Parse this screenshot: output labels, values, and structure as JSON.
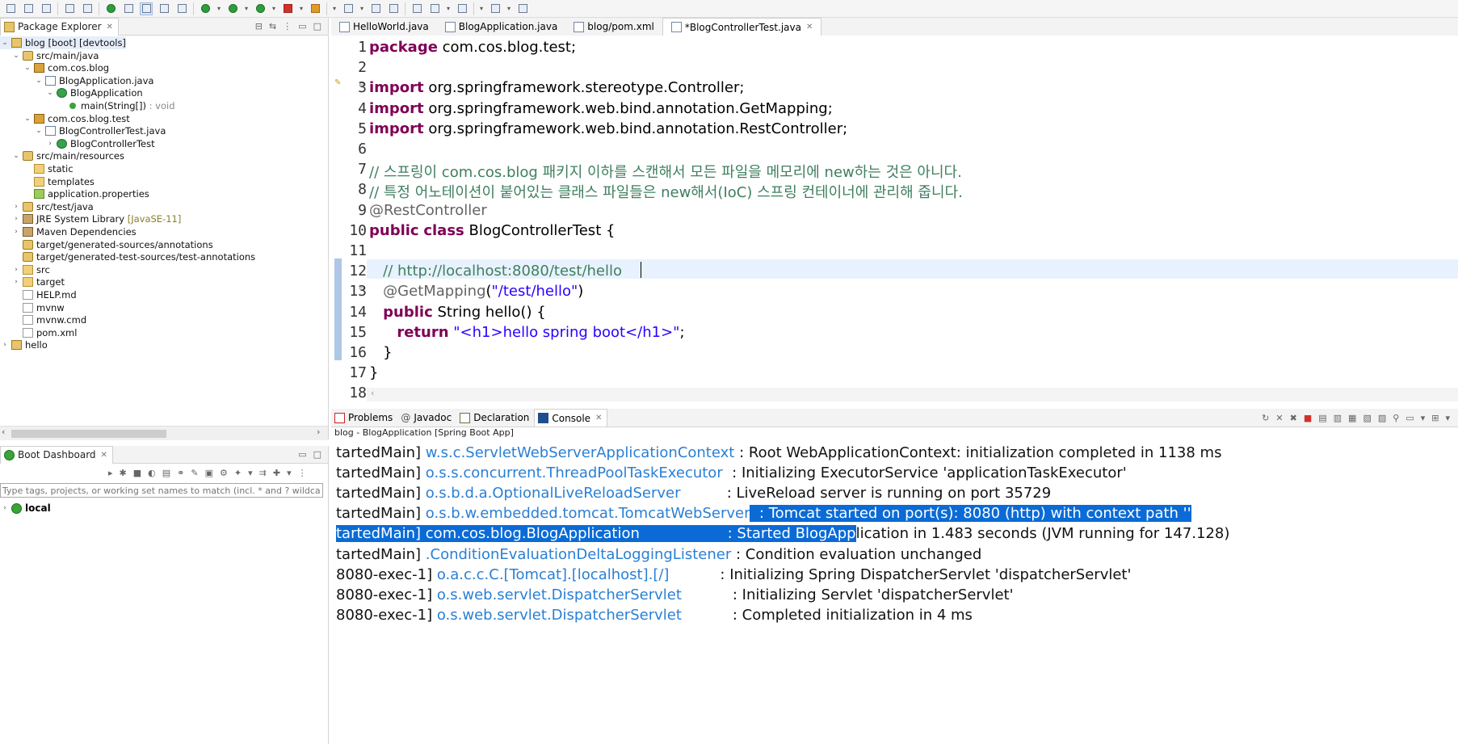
{
  "toolbar": {
    "icons": [
      "new-icon",
      "save-icon",
      "save-all-icon",
      "print-icon",
      "search-icon",
      "spring-boot-icon",
      "open-type-icon",
      "mark-icon",
      "toggle-icon",
      "show-whitespace-icon",
      "debug-icon",
      "run-icon",
      "coverage-icon",
      "stop-icon",
      "external-tools-icon",
      "new-class-icon",
      "refresh-icon",
      "open-folder-icon",
      "pin-icon",
      "next-annotation-icon",
      "back-icon",
      "forward-icon",
      "task-icon"
    ]
  },
  "package_explorer": {
    "title": "Package Explorer",
    "tree": [
      {
        "label": "blog [boot] [devtools]",
        "extra": "",
        "icon": "proj",
        "depth": 0,
        "twisty": "down",
        "selected": true
      },
      {
        "label": "src/main/java",
        "extra": "",
        "icon": "srcf",
        "depth": 1,
        "twisty": "down"
      },
      {
        "label": "com.cos.blog",
        "extra": "",
        "icon": "pkg",
        "depth": 2,
        "twisty": "down"
      },
      {
        "label": "BlogApplication.java",
        "extra": "",
        "icon": "jfile",
        "depth": 3,
        "twisty": "down"
      },
      {
        "label": "BlogApplication",
        "extra": "",
        "icon": "cls",
        "depth": 4,
        "twisty": "down"
      },
      {
        "label": "main(String[])",
        "extra": " : void",
        "icon": "meth",
        "depth": 5,
        "twisty": ""
      },
      {
        "label": "com.cos.blog.test",
        "extra": "",
        "icon": "pkg",
        "depth": 2,
        "twisty": "down"
      },
      {
        "label": "BlogControllerTest.java",
        "extra": "",
        "icon": "jfile",
        "depth": 3,
        "twisty": "down"
      },
      {
        "label": "BlogControllerTest",
        "extra": "",
        "icon": "cls",
        "depth": 4,
        "twisty": "right"
      },
      {
        "label": "src/main/resources",
        "extra": "",
        "icon": "srcf",
        "depth": 1,
        "twisty": "down"
      },
      {
        "label": "static",
        "extra": "",
        "icon": "folder",
        "depth": 2,
        "twisty": ""
      },
      {
        "label": "templates",
        "extra": "",
        "icon": "folder",
        "depth": 2,
        "twisty": ""
      },
      {
        "label": "application.properties",
        "extra": "",
        "icon": "props",
        "depth": 2,
        "twisty": ""
      },
      {
        "label": "src/test/java",
        "extra": "",
        "icon": "srcf",
        "depth": 1,
        "twisty": "right"
      },
      {
        "label": "JRE System Library",
        "extra": " [JavaSE-11]",
        "icon": "lib",
        "depth": 1,
        "twisty": "right"
      },
      {
        "label": "Maven Dependencies",
        "extra": "",
        "icon": "lib",
        "depth": 1,
        "twisty": "right"
      },
      {
        "label": "target/generated-sources/annotations",
        "extra": "",
        "icon": "srcf",
        "depth": 1,
        "twisty": ""
      },
      {
        "label": "target/generated-test-sources/test-annotations",
        "extra": "",
        "icon": "srcf",
        "depth": 1,
        "twisty": ""
      },
      {
        "label": "src",
        "extra": "",
        "icon": "folder",
        "depth": 1,
        "twisty": "right"
      },
      {
        "label": "target",
        "extra": "",
        "icon": "folder",
        "depth": 1,
        "twisty": "right"
      },
      {
        "label": "HELP.md",
        "extra": "",
        "icon": "file",
        "depth": 1,
        "twisty": ""
      },
      {
        "label": "mvnw",
        "extra": "",
        "icon": "file",
        "depth": 1,
        "twisty": ""
      },
      {
        "label": "mvnw.cmd",
        "extra": "",
        "icon": "file",
        "depth": 1,
        "twisty": ""
      },
      {
        "label": "pom.xml",
        "extra": "",
        "icon": "file",
        "depth": 1,
        "twisty": ""
      },
      {
        "label": "hello",
        "extra": "",
        "icon": "proj",
        "depth": 0,
        "twisty": "right"
      }
    ]
  },
  "boot_dashboard": {
    "title": "Boot Dashboard",
    "filter_placeholder": "Type tags, projects, or working set names to match (incl. * and ? wildcards)",
    "items": [
      {
        "label": "local"
      }
    ]
  },
  "editor": {
    "tabs": [
      {
        "label": "HelloWorld.java",
        "icon": "java",
        "active": false
      },
      {
        "label": "BlogApplication.java",
        "icon": "java",
        "active": false
      },
      {
        "label": "blog/pom.xml",
        "icon": "xml",
        "active": false
      },
      {
        "label": "*BlogControllerTest.java",
        "icon": "java",
        "active": true
      }
    ],
    "current_line": 12,
    "lines": [
      {
        "n": "1",
        "parts": [
          {
            "t": "package",
            "c": "kw"
          },
          {
            "t": " com.cos.blog.test;",
            "c": ""
          }
        ]
      },
      {
        "n": "2",
        "parts": []
      },
      {
        "n": "3",
        "parts": [
          {
            "t": "import",
            "c": "kw"
          },
          {
            "t": " org.springframework.stereotype.Controller;",
            "c": ""
          }
        ]
      },
      {
        "n": "4",
        "parts": [
          {
            "t": "import",
            "c": "kw"
          },
          {
            "t": " org.springframework.web.bind.annotation.GetMapping;",
            "c": ""
          }
        ]
      },
      {
        "n": "5",
        "parts": [
          {
            "t": "import",
            "c": "kw"
          },
          {
            "t": " org.springframework.web.bind.annotation.RestController;",
            "c": ""
          }
        ]
      },
      {
        "n": "6",
        "parts": []
      },
      {
        "n": "7",
        "parts": [
          {
            "t": "// 스프링이 com.cos.blog 패키지 이하를 스캔해서 모든 파일을 메모리에 new하는 것은 아니다.",
            "c": "cm"
          }
        ]
      },
      {
        "n": "8",
        "parts": [
          {
            "t": "// 특정 어노테이션이 붙어있는 클래스 파일들은 new해서(IoC) 스프링 컨테이너에 관리해 줍니다.",
            "c": "cm"
          }
        ]
      },
      {
        "n": "9",
        "parts": [
          {
            "t": "@RestController",
            "c": "an"
          }
        ]
      },
      {
        "n": "10",
        "parts": [
          {
            "t": "public",
            "c": "kw"
          },
          {
            "t": " ",
            "c": ""
          },
          {
            "t": "class",
            "c": "kw"
          },
          {
            "t": " BlogControllerTest {",
            "c": ""
          }
        ]
      },
      {
        "n": "11",
        "parts": []
      },
      {
        "n": "12",
        "parts": [
          {
            "t": "   // http://localhost:8080/test/hello",
            "c": "cm"
          }
        ]
      },
      {
        "n": "13",
        "parts": [
          {
            "t": "   @GetMapping",
            "c": "an"
          },
          {
            "t": "(",
            "c": ""
          },
          {
            "t": "\"/test/hello\"",
            "c": "st"
          },
          {
            "t": ")",
            "c": ""
          }
        ]
      },
      {
        "n": "14",
        "parts": [
          {
            "t": "   ",
            "c": ""
          },
          {
            "t": "public",
            "c": "kw"
          },
          {
            "t": " String hello() {",
            "c": ""
          }
        ]
      },
      {
        "n": "15",
        "parts": [
          {
            "t": "      ",
            "c": ""
          },
          {
            "t": "return",
            "c": "kw"
          },
          {
            "t": " ",
            "c": ""
          },
          {
            "t": "\"<h1>hello spring boot</h1>\"",
            "c": "st"
          },
          {
            "t": ";",
            "c": ""
          }
        ]
      },
      {
        "n": "16",
        "parts": [
          {
            "t": "   }",
            "c": ""
          }
        ]
      },
      {
        "n": "17",
        "parts": [
          {
            "t": "}",
            "c": ""
          }
        ]
      },
      {
        "n": "18",
        "parts": []
      }
    ]
  },
  "bottom_panel": {
    "tabs": [
      {
        "label": "Problems",
        "icon": "problems",
        "active": false
      },
      {
        "label": "Javadoc",
        "icon": "at",
        "active": false
      },
      {
        "label": "Declaration",
        "icon": "decl",
        "active": false
      },
      {
        "label": "Console",
        "icon": "console",
        "active": true
      }
    ],
    "console_title": "blog - BlogApplication [Spring Boot App]",
    "lines": [
      {
        "thread": "tartedMain]",
        "logger": "w.s.c.ServletWebServerApplicationContext",
        "pad": " ",
        "msg": ": Root WebApplicationContext: initialization completed in 1138 ms",
        "hl": "none"
      },
      {
        "thread": "tartedMain]",
        "logger": "o.s.s.concurrent.ThreadPoolTaskExecutor",
        "pad": "  ",
        "msg": ": Initializing ExecutorService 'applicationTaskExecutor'",
        "hl": "none"
      },
      {
        "thread": "tartedMain]",
        "logger": "o.s.b.d.a.OptionalLiveReloadServer",
        "pad": "          ",
        "msg": ": LiveReload server is running on port 35729",
        "hl": "none"
      },
      {
        "thread": "tartedMain]",
        "logger": "o.s.b.w.embedded.tomcat.TomcatWebServer",
        "pad": "  ",
        "msg": ": Tomcat started on port(s): 8080 (http) with context path ''",
        "hl": "msg"
      },
      {
        "thread": "tartedMain]",
        "logger": "com.cos.blog.BlogApplication",
        "pad": "                   ",
        "msg": ": Started BlogApp",
        "rest": "lication in 1.483 seconds (JVM running for 147.128)",
        "hl": "full"
      },
      {
        "thread": "tartedMain]",
        "logger": ".ConditionEvaluationDeltaLoggingListener",
        "pad": " ",
        "msg": ": Condition evaluation unchanged",
        "hl": "none"
      },
      {
        "thread": "8080-exec-1]",
        "logger": "o.a.c.c.C.[Tomcat].[localhost].[/]",
        "pad": "           ",
        "msg": ": Initializing Spring DispatcherServlet 'dispatcherServlet'",
        "hl": "none"
      },
      {
        "thread": "8080-exec-1]",
        "logger": "o.s.web.servlet.DispatcherServlet",
        "pad": "           ",
        "msg": ": Initializing Servlet 'dispatcherServlet'",
        "hl": "none"
      },
      {
        "thread": "8080-exec-1]",
        "logger": "o.s.web.servlet.DispatcherServlet",
        "pad": "           ",
        "msg": ": Completed initialization in 4 ms",
        "hl": "none"
      }
    ]
  },
  "colors": {
    "keyword": "#7f0055",
    "comment": "#3f7f5f",
    "string": "#2a00ff",
    "logger": "#2a7fd4",
    "selection": "#0a6bd6"
  }
}
